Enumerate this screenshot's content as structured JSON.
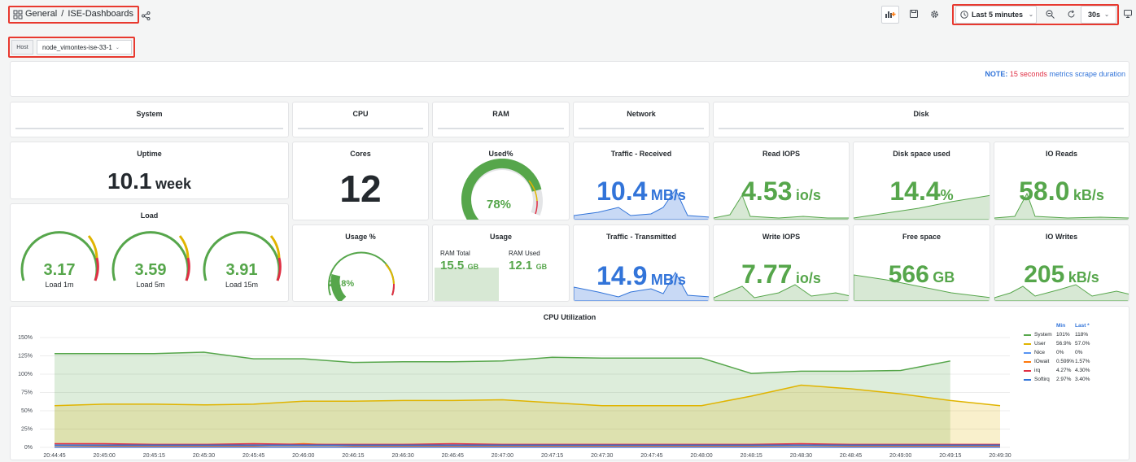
{
  "header": {
    "folder": "General",
    "separator": "/",
    "dashboard": "ISE-Dashboards",
    "time_range": "Last 5 minutes",
    "refresh": "30s"
  },
  "icons": {
    "grid": "grid-icon",
    "share": "share-icon",
    "add_panel": "add-panel-icon",
    "save": "save-icon",
    "settings": "gear-icon",
    "clock": "clock-icon",
    "zoom_out": "zoom-out-icon",
    "refresh": "refresh-icon",
    "tv": "tv-mode-icon"
  },
  "variables": {
    "host_label": "Host",
    "host_value": "node_vimontes-ise-33-1"
  },
  "note": {
    "label": "NOTE:",
    "highlight": "15 seconds",
    "text": "metrics scrape duration"
  },
  "rows": {
    "system": "System",
    "cpu": "CPU",
    "ram": "RAM",
    "network": "Network",
    "disk": "Disk"
  },
  "panels": {
    "uptime": {
      "title": "Uptime",
      "value": "10.1",
      "unit": "week"
    },
    "load": {
      "title": "Load",
      "gauges": [
        {
          "value": "3.17",
          "label": "Load 1m",
          "level": 0.5
        },
        {
          "value": "3.59",
          "label": "Load 5m",
          "level": 0.55
        },
        {
          "value": "3.91",
          "label": "Load 15m",
          "level": 0.6
        }
      ]
    },
    "cores": {
      "title": "Cores",
      "value": "12"
    },
    "cpu_usage": {
      "title": "Usage %",
      "value": "21.8%",
      "level": 0.218
    },
    "ram_used": {
      "title": "Used%",
      "value": "78%",
      "level": 0.78
    },
    "ram_usage": {
      "title": "Usage",
      "total_label": "RAM Total",
      "total_value": "15.5",
      "total_unit": "GB",
      "used_label": "RAM Used",
      "used_value": "12.1",
      "used_unit": "GB"
    },
    "traffic_rx": {
      "title": "Traffic - Received",
      "value": "10.4",
      "unit": "MB/s"
    },
    "traffic_tx": {
      "title": "Traffic - Transmitted",
      "value": "14.9",
      "unit": "MB/s"
    },
    "read_iops": {
      "title": "Read IOPS",
      "value": "4.53",
      "unit": "io/s"
    },
    "write_iops": {
      "title": "Write IOPS",
      "value": "7.77",
      "unit": "io/s"
    },
    "disk_used": {
      "title": "Disk space used",
      "value": "14.4",
      "unit": "%"
    },
    "free_space": {
      "title": "Free space",
      "value": "566",
      "unit": "GB"
    },
    "io_reads": {
      "title": "IO Reads",
      "value": "58.0",
      "unit": "kB/s"
    },
    "io_writes": {
      "title": "IO Writes",
      "value": "205",
      "unit": "kB/s"
    }
  },
  "colors": {
    "green": "#56a64b",
    "yellow": "#e0b400",
    "blue": "#3274d9",
    "red": "#e02f44",
    "orange": "#ff780a",
    "purple": "#8f3bb8"
  },
  "chart_data": {
    "type": "area",
    "title": "CPU Utilization",
    "y_ticks": [
      "150%",
      "125%",
      "100%",
      "75%",
      "50%",
      "25%",
      "0%"
    ],
    "ylim": [
      0,
      150
    ],
    "x": [
      "20:44:45",
      "20:45:00",
      "20:45:15",
      "20:45:30",
      "20:45:45",
      "20:46:00",
      "20:46:15",
      "20:46:30",
      "20:46:45",
      "20:47:00",
      "20:47:15",
      "20:47:30",
      "20:47:45",
      "20:48:00",
      "20:48:15",
      "20:48:30",
      "20:48:45",
      "20:49:00",
      "20:49:15",
      "20:49:30"
    ],
    "legend_headers": {
      "min": "Min",
      "last": "Last *"
    },
    "series": [
      {
        "name": "System",
        "color": "#56a64b",
        "min": "101%",
        "last": "118%",
        "values": [
          128,
          128,
          128,
          130,
          121,
          121,
          116,
          117,
          117,
          118,
          123,
          122,
          122,
          122,
          101,
          104,
          104,
          105,
          118,
          null
        ]
      },
      {
        "name": "User",
        "color": "#e0b400",
        "min": "56.9%",
        "last": "57.0%",
        "values": [
          57,
          59,
          59,
          58,
          59,
          63,
          63,
          64,
          64,
          65,
          61,
          57,
          57,
          57,
          70,
          85,
          80,
          73,
          64,
          57
        ]
      },
      {
        "name": "Nice",
        "color": "#5794f2",
        "min": "0%",
        "last": "0%",
        "values": [
          0,
          0,
          0,
          0,
          0,
          0,
          0,
          0,
          0,
          0,
          0,
          0,
          0,
          0,
          0,
          0,
          0,
          0,
          0,
          0
        ]
      },
      {
        "name": "IOwait",
        "color": "#ff780a",
        "min": "0.599%",
        "last": "1.57%",
        "values": [
          3,
          2,
          2,
          2,
          2,
          5,
          2,
          2,
          2,
          2,
          2,
          2,
          2,
          2,
          2,
          3,
          2,
          2,
          2,
          2
        ]
      },
      {
        "name": "irq",
        "color": "#e02f44",
        "min": "4.27%",
        "last": "4.30%",
        "values": [
          5,
          5,
          4,
          4,
          5,
          4,
          4,
          4,
          5,
          4,
          4,
          4,
          4,
          4,
          4,
          5,
          4,
          4,
          4,
          4
        ]
      },
      {
        "name": "Softirq",
        "color": "#3274d9",
        "min": "2.97%",
        "last": "3.40%",
        "values": [
          3,
          3,
          3,
          3,
          3,
          3,
          3,
          3,
          3,
          3,
          3,
          3,
          3,
          3,
          3,
          3,
          3,
          3,
          3,
          3
        ]
      }
    ]
  }
}
